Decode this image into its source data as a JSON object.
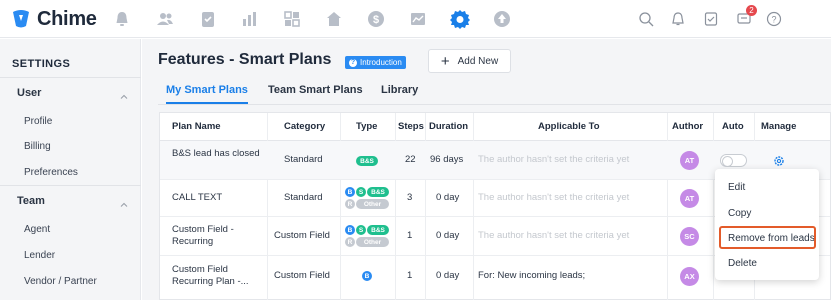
{
  "app": {
    "brand": "Chime",
    "accent": "#1a7fe8",
    "brand_color": "#2a8bf2"
  },
  "topnav": {
    "icons": [
      "alert-bell-icon",
      "contacts-icon",
      "tasks-icon",
      "reports-icon",
      "dashboard-icon",
      "home-icon",
      "dollar-icon",
      "analytics-icon",
      "settings-gear-icon",
      "upload-icon"
    ],
    "right_icons": [
      "search-icon",
      "bell-icon",
      "checklist-icon",
      "messages-icon",
      "help-icon"
    ],
    "messages_badge": "2"
  },
  "sidebar": {
    "heading": "SETTINGS",
    "groups": [
      {
        "label": "User",
        "items": [
          "Profile",
          "Billing",
          "Preferences"
        ]
      },
      {
        "label": "Team",
        "items": [
          "Agent",
          "Lender",
          "Vendor / Partner"
        ]
      }
    ]
  },
  "header": {
    "title": "Features - Smart Plans",
    "intro_badge": "Introduction",
    "add_button": "Add New"
  },
  "tabs": [
    "My Smart Plans",
    "Team Smart Plans",
    "Library"
  ],
  "table": {
    "columns": [
      "Plan Name",
      "Category",
      "Type",
      "Steps",
      "Duration",
      "Applicable To",
      "Author",
      "Auto",
      "Manage"
    ],
    "rows": [
      {
        "name": "B&S lead has closed",
        "category": "Standard",
        "type_pills": [
          "B&S"
        ],
        "steps": "22",
        "duration": "96 days",
        "applicable": "The author hasn't set the criteria yet",
        "author": "AT"
      },
      {
        "name": "CALL TEXT",
        "category": "Standard",
        "type_pills": [
          "B",
          "S",
          "B&S",
          "R",
          "Other"
        ],
        "steps": "3",
        "duration": "0 day",
        "applicable": "The author hasn't set the criteria yet",
        "author": "AT"
      },
      {
        "name": "Custom Field - Recurring",
        "category": "Custom Field",
        "type_pills": [
          "B",
          "S",
          "B&S",
          "R",
          "Other"
        ],
        "steps": "1",
        "duration": "0 day",
        "applicable": "The author hasn't set the criteria yet",
        "author": "SC"
      },
      {
        "name": "Custom Field Recurring Plan -...",
        "category": "Custom Field",
        "type_pills": [
          "B"
        ],
        "steps": "1",
        "duration": "0 day",
        "applicable": "For: New incoming leads;",
        "author": "AX"
      }
    ]
  },
  "dropdown": {
    "items": [
      "Edit",
      "Copy",
      "Remove from leads",
      "Delete"
    ],
    "highlight_color": "#e35b2a"
  }
}
